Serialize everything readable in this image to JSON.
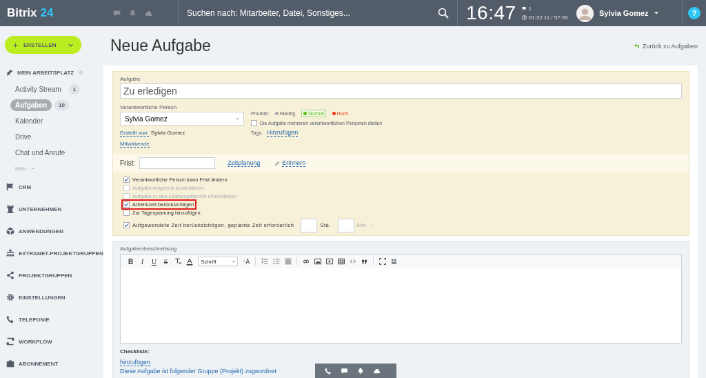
{
  "header": {
    "logo_text": "Bitrix",
    "logo_number": "24",
    "search_placeholder": "Suchen nach: Mitarbeiter, Datei, Sonstiges...",
    "clock": "16:47",
    "flag_count": "1",
    "timer": "01:32:11 / 57:00",
    "user_name": "Sylvia Gomez",
    "help": "?"
  },
  "sidebar": {
    "create_button": "ERSTELLEN",
    "workspace": {
      "label": "MEIN ARBEITSPLATZ",
      "items": [
        {
          "label": "Activity Stream",
          "count": "1",
          "selected": false
        },
        {
          "label": "Aufgaben",
          "count": "10",
          "selected": true
        },
        {
          "label": "Kalender",
          "selected": false
        },
        {
          "label": "Drive",
          "selected": false
        },
        {
          "label": "Chat und Anrufe",
          "selected": false
        }
      ],
      "more": "Mehr..."
    },
    "sections": [
      "CRM",
      "UNTERNEHMEN",
      "ANWENDUNGEN",
      "EXTRANET-PROJEKTGRUPPEN",
      "PROJEKTGRUPPEN",
      "EINSTELLUNGEN",
      "TELEFONIE",
      "WORKFLOW",
      "ABONNEMENT"
    ]
  },
  "page": {
    "title": "Neue Aufgabe",
    "back_link": "Zurück zu Aufgaben"
  },
  "task": {
    "title_label": "Aufgabe",
    "title_value": "Zu erledigen",
    "responsible_label": "Verantwortliche Person",
    "responsible_value": "Sylvia Gomez",
    "created_by_label": "Erstellt von:",
    "created_by": "Sylvia Gomez",
    "participants_link": "Mitwirkende",
    "priority_label": "Priorität:",
    "priorities": [
      {
        "label": "Niedrig",
        "color": "#a8adb4",
        "selected": false
      },
      {
        "label": "Normal",
        "color": "#5fba1c",
        "selected": true
      },
      {
        "label": "Hoch",
        "color": "#f0371b",
        "selected": false
      }
    ],
    "multi_responsible": {
      "label": "Die Aufgabe mehreren verantwortlichen Personen stellen",
      "checked": false
    },
    "tags_label": "Tags:",
    "tags_link": "Hinzufügen",
    "deadline_label": "Frist:",
    "planning_link": "Zeitplanung",
    "remind_link": "Erinnern",
    "options": [
      {
        "kind": "check",
        "label": "Verantwortliche Person kann Frist ändern",
        "checked": true,
        "disabled": false,
        "highlighted": false
      },
      {
        "kind": "check",
        "label": "Aufgabenergebnis kontrollieren",
        "checked": false,
        "disabled": true,
        "highlighted": false
      },
      {
        "kind": "check",
        "label": "Aufgabe in den Leistungsbericht einschließen",
        "checked": false,
        "disabled": true,
        "highlighted": false
      },
      {
        "kind": "check",
        "label": "Arbeitszeit berücksichtigen",
        "checked": true,
        "disabled": false,
        "highlighted": true
      },
      {
        "kind": "check",
        "label": "Zur Tagesplanung hinzufügen",
        "checked": false,
        "disabled": false,
        "highlighted": false
      },
      {
        "kind": "time",
        "label": "Aufgewendete Zeit berücksichtigen, geplante Zeit erforderlich",
        "checked": true,
        "disabled": false,
        "highlighted": false,
        "hours_label": "Std.",
        "minutes_label": "Min."
      }
    ],
    "description_label": "Aufgabenbeschreibung",
    "format_buttons": [
      {
        "kind": "bold",
        "label": "B"
      },
      {
        "kind": "italic",
        "label": "I"
      },
      {
        "kind": "underline",
        "label": "U"
      },
      {
        "kind": "strike",
        "label": "S"
      }
    ],
    "font_select": "Schrift",
    "checklist_title": "Checkliste:",
    "checklist_link": "hinzufügen",
    "group_text": "Diese Aufgabe ist folgender Gruppe (Projekt) zugeordnet"
  }
}
